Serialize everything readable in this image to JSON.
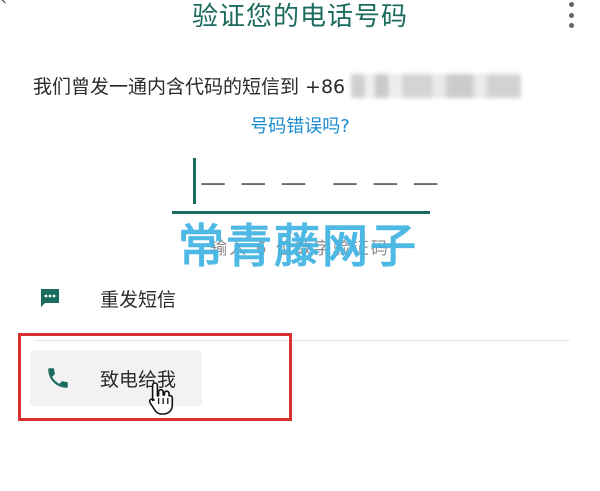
{
  "header": {
    "title": "验证您的电话号码",
    "back_icon": "chevron-left-icon",
    "menu_icon": "more-vertical-icon"
  },
  "verification": {
    "sent_text": "我们曾发一通内含代码的短信到 +86",
    "wrong_number_link": "号码错误吗?",
    "code_placeholder": "— — —  — — —",
    "code_hint": "输入 6 位数字验证码"
  },
  "options": {
    "resend_sms_label": "重发短信",
    "resend_sms_icon": "message-icon",
    "call_me_label": "致电给我",
    "call_me_icon": "phone-icon"
  },
  "watermark": "常青藤网子",
  "colors": {
    "accent": "#1b6b5e",
    "link": "#1a8ccf",
    "highlight": "#d9322e"
  }
}
